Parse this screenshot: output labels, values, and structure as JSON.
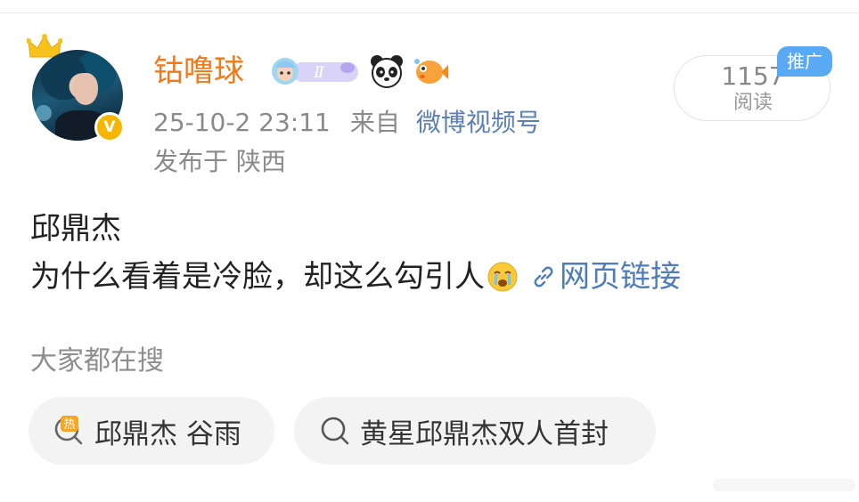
{
  "header": {
    "username": "钴噜球",
    "timestamp": "25-10-2 23:11",
    "from_label": "来自",
    "source": "微博视频号",
    "location": "发布于 陕西"
  },
  "badges": {
    "member_level": "Ⅱ"
  },
  "stats": {
    "reads_count": "1157",
    "reads_label": "阅读",
    "promo_badge": "推广"
  },
  "post": {
    "title": "邱鼎杰",
    "text": "为什么看着是冷脸，却这么勾引人",
    "link_text": "网页链接"
  },
  "searches": {
    "title": "大家都在搜",
    "hot_icon_char": "热",
    "items": [
      {
        "label": "邱鼎杰 谷雨",
        "icon": "hot-search-icon"
      },
      {
        "label": "黄星邱鼎杰双人首封",
        "icon": "search-icon"
      }
    ]
  },
  "colors": {
    "username": "#f07a1a",
    "source": "#5b7fb3",
    "link": "#4f7db8",
    "promo": "#5aa9f5",
    "verified": "#f7b500",
    "hot": "#f5a623"
  },
  "verified_badge": "V"
}
